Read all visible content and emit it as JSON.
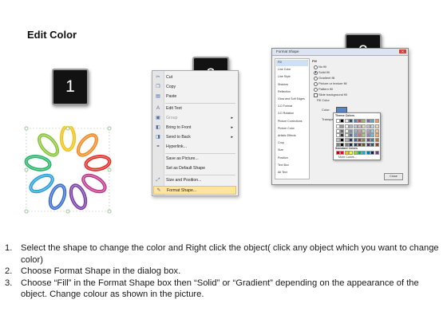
{
  "page": {
    "title": "Edit Color",
    "badges": [
      "1",
      "2",
      "3"
    ]
  },
  "context_menu": {
    "items": [
      {
        "label": "Cut",
        "icon": "scissors-icon",
        "disabled": false,
        "submenu": false
      },
      {
        "label": "Copy",
        "icon": "copy-icon",
        "disabled": false,
        "submenu": false
      },
      {
        "label": "Paste",
        "icon": "paste-icon",
        "disabled": false,
        "submenu": false
      },
      {
        "label": "Edit Text",
        "icon": "edit-text-icon",
        "disabled": false,
        "submenu": false
      },
      {
        "label": "Group",
        "icon": "group-icon",
        "disabled": true,
        "submenu": true
      },
      {
        "label": "Bring to Front",
        "icon": "bring-front-icon",
        "disabled": false,
        "submenu": true
      },
      {
        "label": "Send to Back",
        "icon": "send-back-icon",
        "disabled": false,
        "submenu": true
      },
      {
        "label": "Hyperlink...",
        "icon": "hyperlink-icon",
        "disabled": false,
        "submenu": false
      },
      {
        "label": "Save as Picture...",
        "icon": "",
        "disabled": false,
        "submenu": false
      },
      {
        "label": "Set as Default Shape",
        "icon": "",
        "disabled": false,
        "submenu": false
      },
      {
        "label": "Size and Position...",
        "icon": "size-icon",
        "disabled": false,
        "submenu": false
      },
      {
        "label": "Format Shape...",
        "icon": "format-shape-icon",
        "disabled": false,
        "submenu": false,
        "highlighted": true
      }
    ]
  },
  "dialog": {
    "title": "Format Shape",
    "categories": [
      "Fill",
      "Line Color",
      "Line Style",
      "Shadow",
      "Reflection",
      "Glow and Soft Edges",
      "3-D Format",
      "3-D Rotation",
      "Picture Corrections",
      "Picture Color",
      "Artistic Effects",
      "Crop",
      "Size",
      "Position",
      "Text Box",
      "Alt Text"
    ],
    "selected_category": "Fill",
    "fill_heading": "Fill",
    "options": [
      {
        "label": "No fill",
        "type": "radio",
        "checked": false
      },
      {
        "label": "Solid fill",
        "type": "radio",
        "checked": true
      },
      {
        "label": "Gradient fill",
        "type": "radio",
        "checked": false
      },
      {
        "label": "Picture or texture fill",
        "type": "radio",
        "checked": false
      },
      {
        "label": "Pattern fill",
        "type": "radio",
        "checked": false
      },
      {
        "label": "Slide background fill",
        "type": "checkbox",
        "checked": false
      }
    ],
    "fill_color_label": "Fill Color",
    "color_label": "Color:",
    "transparency_label": "Transparency:",
    "popup": {
      "theme_colors_label": "Theme Colors",
      "standard_colors_label": "Standard Colors",
      "more_colors_label": "More Colors...",
      "theme_top_row": [
        "#ffffff",
        "#000000",
        "#eeece1",
        "#1f497d",
        "#4f81bd",
        "#c0504d",
        "#9bbb59",
        "#8064a2",
        "#4bacc6",
        "#f79646"
      ],
      "standard_colors": [
        "#c00000",
        "#ff0000",
        "#ffc000",
        "#ffff00",
        "#92d050",
        "#00b050",
        "#00b0f0",
        "#0070c0",
        "#002060",
        "#7030a0"
      ]
    },
    "close_label": "Close"
  },
  "steps": [
    {
      "num": "1.",
      "text": "Select the shape to change the color and Right click the object( click any object which you want to change color)"
    },
    {
      "num": "2.",
      "text": "Choose Format Shape in the dialog box."
    },
    {
      "num": "3.",
      "text": "Choose “Fill” in the Format Shape box then “Solid” or “Gradient” depending on the appearance of the object. Change colour as shown in the picture."
    }
  ],
  "colors": {
    "chain_links": [
      "#f0c419",
      "#f28c28",
      "#e1312c",
      "#c0398f",
      "#7b3fa8",
      "#3b6fd0",
      "#2aa0dc",
      "#2ab56a",
      "#8cc63f"
    ],
    "selection_handle": "#8fc98f",
    "menu_highlight": "#fde59c"
  }
}
